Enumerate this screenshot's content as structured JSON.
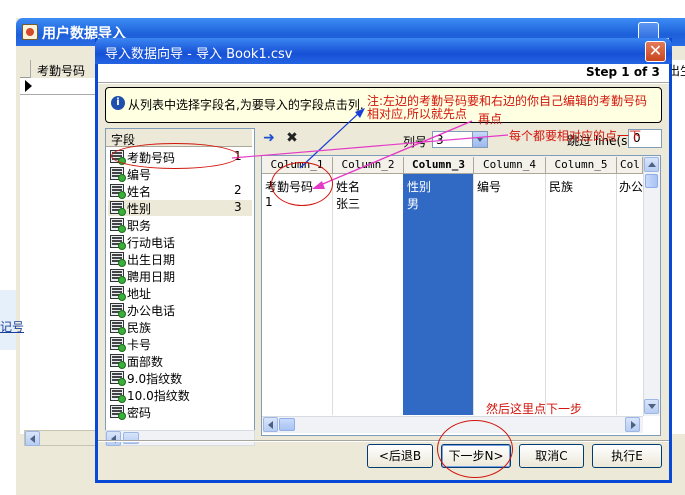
{
  "outer_window": {
    "title": "用户数据导入",
    "column_header": "考勤号码",
    "right_edge_text": "出生",
    "left_edge_text": "记号"
  },
  "dialog": {
    "title": "导入数据向导 - 导入 Book1.csv",
    "close_glyph": "✕",
    "step": "Step 1 of 3",
    "info": "从列表中选择字段名,为要导入的字段点击列."
  },
  "fields_panel": {
    "header": "字段",
    "items": [
      {
        "name": "考勤号码",
        "col": "1"
      },
      {
        "name": "编号",
        "col": ""
      },
      {
        "name": "姓名",
        "col": "2"
      },
      {
        "name": "性别",
        "col": "3"
      },
      {
        "name": "职务",
        "col": ""
      },
      {
        "name": "行动电话",
        "col": ""
      },
      {
        "name": "出生日期",
        "col": ""
      },
      {
        "name": "聘用日期",
        "col": ""
      },
      {
        "name": "地址",
        "col": ""
      },
      {
        "name": "办公电话",
        "col": ""
      },
      {
        "name": "民族",
        "col": ""
      },
      {
        "name": "卡号",
        "col": ""
      },
      {
        "name": "面部数",
        "col": ""
      },
      {
        "name": "9.0指纹数",
        "col": ""
      },
      {
        "name": "10.0指纹数",
        "col": ""
      },
      {
        "name": "密码",
        "col": ""
      }
    ]
  },
  "toolbar": {
    "arrow_glyph": "➜",
    "x_glyph": "✖",
    "col_num_label": "列号",
    "col_num_value": "3",
    "skip_label": "跳过 line(s)",
    "skip_value": "0"
  },
  "grid": {
    "headers": [
      "Column_1",
      "Column_2",
      "Column_3",
      "Column_4",
      "Column_5",
      "Col"
    ],
    "rows": [
      [
        "考勤号码",
        "姓名",
        "性别",
        "编号",
        "民族",
        "办公"
      ],
      [
        "1",
        "张三",
        "男",
        "",
        "",
        ""
      ]
    ]
  },
  "buttons": {
    "back": "<后退B",
    "next": "下一步N>",
    "cancel": "取消C",
    "execute": "执行E"
  },
  "annotations": {
    "note_line1": "注:左边的考勤号码要和右边的你自己编辑的考勤号码",
    "note_line2": "相对应,所以就先点",
    "note_tail": "再点",
    "each": "每个都要相对应的点一下",
    "then": "然后这里点下一步"
  },
  "colors": {
    "title_blue": "#1c5fd9",
    "selection": "#316ac5",
    "annotation_red": "#d1150c",
    "annotation_blue": "#1a3fd6",
    "info_bg": "#ffffe1"
  }
}
